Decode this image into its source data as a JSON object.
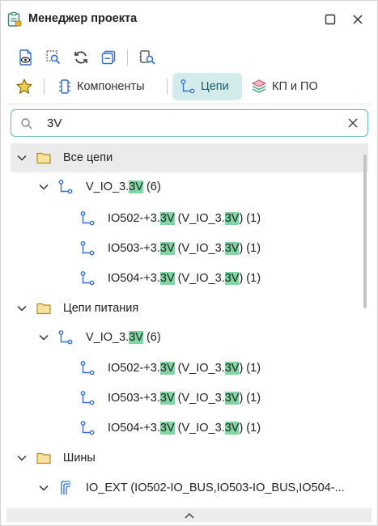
{
  "window": {
    "title": "Менеджер проекта"
  },
  "tabs": [
    {
      "label": ""
    },
    {
      "label": "Компоненты"
    },
    {
      "label": "Цепи"
    },
    {
      "label": "КП и ПО"
    }
  ],
  "search": {
    "value": "3V"
  },
  "tree": [
    {
      "pre": "Все цепи",
      "hl": "",
      "post": ""
    },
    {
      "pre": "V_IO_3.",
      "hl": "3V",
      "post": " (6)"
    },
    {
      "pre": "IO502-+3.",
      "hl": "3V",
      "mid": " (V_IO_3.",
      "hl2": "3V",
      "post": ") (1)"
    },
    {
      "pre": "IO503-+3.",
      "hl": "3V",
      "mid": " (V_IO_3.",
      "hl2": "3V",
      "post": ") (1)"
    },
    {
      "pre": "IO504-+3.",
      "hl": "3V",
      "mid": " (V_IO_3.",
      "hl2": "3V",
      "post": ") (1)"
    },
    {
      "pre": "Цепи питания",
      "hl": "",
      "post": ""
    },
    {
      "pre": "V_IO_3.",
      "hl": "3V",
      "post": " (6)"
    },
    {
      "pre": "IO502-+3.",
      "hl": "3V",
      "mid": " (V_IO_3.",
      "hl2": "3V",
      "post": ") (1)"
    },
    {
      "pre": "IO503-+3.",
      "hl": "3V",
      "mid": " (V_IO_3.",
      "hl2": "3V",
      "post": ") (1)"
    },
    {
      "pre": "IO504-+3.",
      "hl": "3V",
      "mid": " (V_IO_3.",
      "hl2": "3V",
      "post": ") (1)"
    },
    {
      "pre": "Шины",
      "hl": "",
      "post": ""
    },
    {
      "pre": "IO_EXT (IO502-IO_BUS,IO503-IO_BUS,IO504-...",
      "hl": "",
      "post": ""
    }
  ],
  "icons": {
    "title": "project-manager-icon",
    "minimize": "square-icon",
    "close": "close-icon",
    "toolbar": [
      "document-eye-icon",
      "zoom-selection-icon",
      "refresh-icon",
      "collapse-icon",
      "find-in-tree-icon"
    ],
    "tabs": [
      "star-icon",
      "component-icon",
      "net-icon",
      "layers-icon"
    ],
    "search": "search-icon",
    "clear": "close-icon",
    "scroll_up": "chevron-up-icon"
  },
  "colors": {
    "accent": "#2f6fd0",
    "tab_active_bg": "#d4ebeb",
    "search_border": "#6bb7b9",
    "highlight": "#7fd6a3",
    "folder": "#e8c25c",
    "star": "#e3b52a",
    "layers": "#3aa07a"
  }
}
